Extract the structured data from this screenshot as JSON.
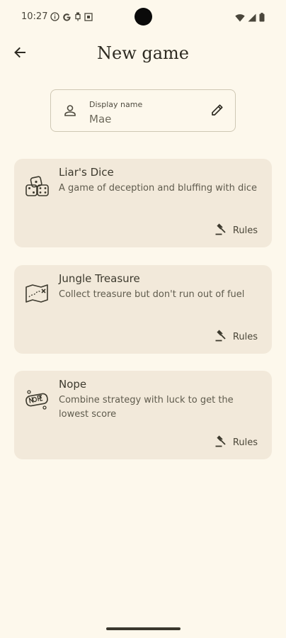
{
  "status_bar": {
    "time": "10:27",
    "left_icons": [
      "info-icon",
      "google-icon",
      "usb-icon",
      "app-icon"
    ],
    "right_icons": [
      "wifi-icon",
      "signal-icon",
      "battery-icon"
    ]
  },
  "header": {
    "title": "New game",
    "back_icon": "arrow-left-icon"
  },
  "display_name": {
    "label": "Display name",
    "value": "Mae",
    "icon": "person-icon",
    "edit_icon": "pencil-icon"
  },
  "games": [
    {
      "title": "Liar's Dice",
      "description": "A game of deception and bluffing with dice",
      "icon": "dice-icon",
      "rules_label": "Rules"
    },
    {
      "title": "Jungle Treasure",
      "description": "Collect treasure but don't run out of fuel",
      "icon": "treasure-map-icon",
      "rules_label": "Rules"
    },
    {
      "title": "Nope",
      "description": "Combine strategy with luck to get the lowest score",
      "icon": "nope-icon",
      "rules_label": "Rules"
    }
  ],
  "colors": {
    "background": "#fdf8ec",
    "card": "#f2e9da",
    "text": "#3d3a2e"
  }
}
